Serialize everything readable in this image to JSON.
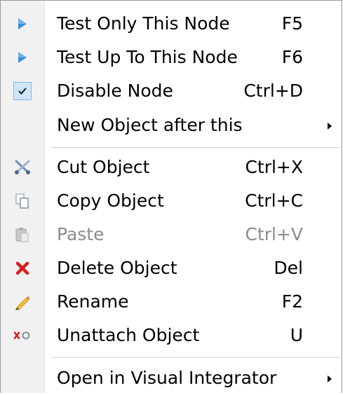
{
  "menu": {
    "items": [
      {
        "label": "Test Only This Node",
        "shortcut": "F5",
        "icon": "play-icon"
      },
      {
        "label": "Test Up To This Node",
        "shortcut": "F6",
        "icon": "play-icon"
      },
      {
        "label": "Disable Node",
        "shortcut": "Ctrl+D",
        "icon": "checkmark-icon",
        "checked": true
      },
      {
        "label": "New Object after this",
        "submenu": true
      },
      {
        "label": "Cut Object",
        "shortcut": "Ctrl+X",
        "icon": "scissors-icon"
      },
      {
        "label": "Copy Object",
        "shortcut": "Ctrl+C",
        "icon": "copy-icon"
      },
      {
        "label": "Paste",
        "shortcut": "Ctrl+V",
        "icon": "paste-icon",
        "disabled": true
      },
      {
        "label": "Delete Object",
        "shortcut": "Del",
        "icon": "delete-x-icon"
      },
      {
        "label": "Rename",
        "shortcut": "F2",
        "icon": "pencil-icon"
      },
      {
        "label": "Unattach Object",
        "shortcut": "U",
        "icon": "unattach-icon"
      },
      {
        "label": "Open in Visual Integrator",
        "submenu": true
      }
    ]
  },
  "colors": {
    "play": "#3a8fd8",
    "delete": "#d42020",
    "check_bg": "#cfe5f8",
    "check_border": "#7fb8e6",
    "disabled_text": "#8c8c8c"
  }
}
